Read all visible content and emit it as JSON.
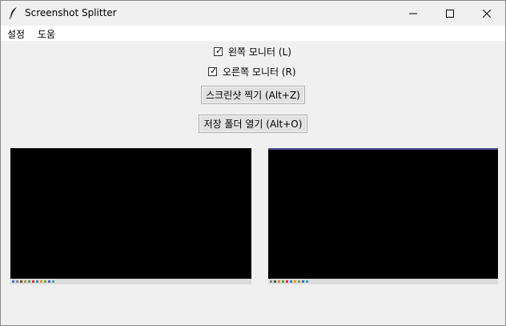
{
  "window": {
    "title": "Screenshot Splitter"
  },
  "menu": {
    "items": [
      "설정",
      "도움"
    ]
  },
  "controls": {
    "left_monitor_label": "왼쪽 모니터 (L)",
    "left_monitor_checked": true,
    "right_monitor_label": "오른쪽 모니터 (R)",
    "right_monitor_checked": true,
    "capture_button": "스크린샷 찍기 (Alt+Z)",
    "open_folder_button": "저장 폴더 열기 (Alt+O)"
  },
  "previews": {
    "left_name": "left-monitor-preview",
    "right_name": "right-monitor-preview"
  },
  "colors": {
    "background": "#f0f0f0",
    "preview": "#000000",
    "button": "#e1e1e1"
  }
}
